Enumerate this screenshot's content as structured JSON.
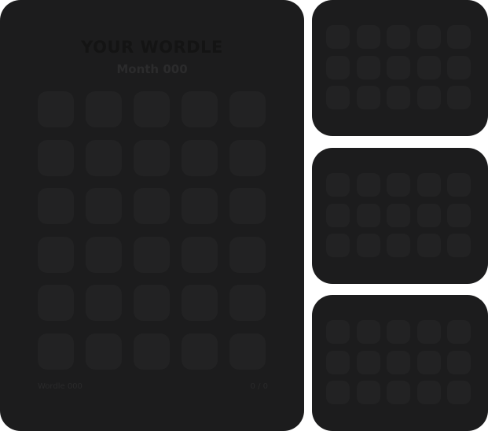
{
  "main": {
    "title": "YOUR WORDLE",
    "subtitle": "Month 000",
    "footer_left": "Wordle 000",
    "footer_right": "0 / 0",
    "grid": {
      "rows": 6,
      "cols": 5
    }
  },
  "previews": [
    {
      "rows": 3,
      "cols": 5
    },
    {
      "rows": 3,
      "cols": 5
    },
    {
      "rows": 3,
      "cols": 5
    }
  ],
  "colors": {
    "card_background": "#1c1c1d",
    "tile_empty": "#222223",
    "page_background": "#ffffff"
  }
}
